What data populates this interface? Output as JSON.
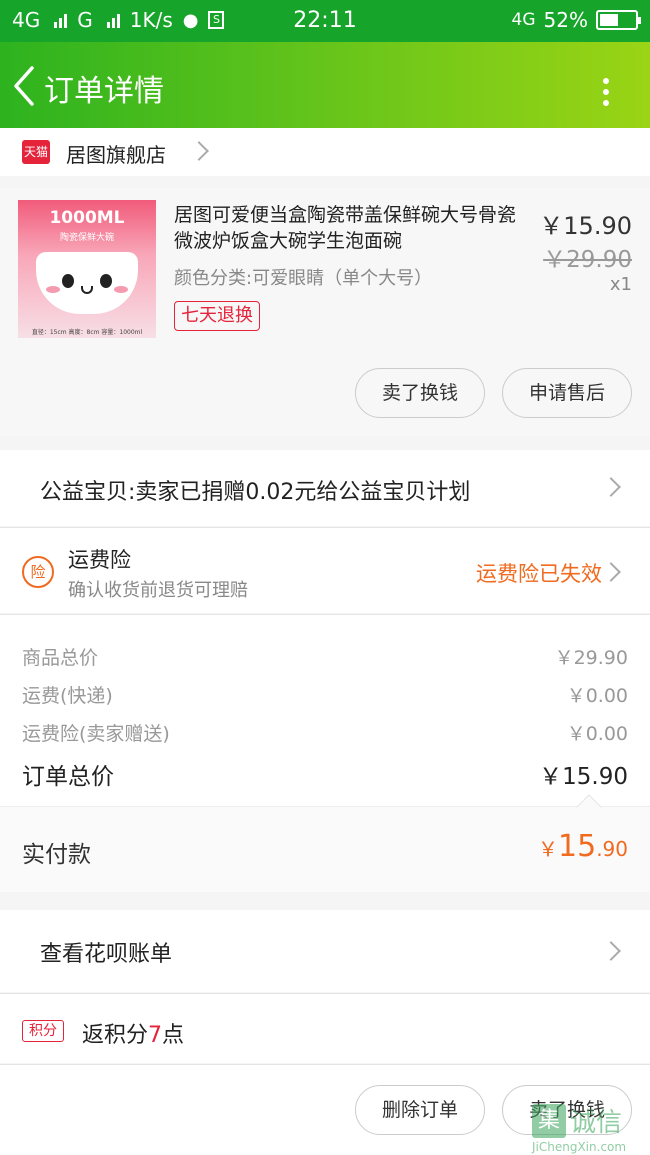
{
  "status_bar": {
    "network1": "4G",
    "network2": "G",
    "speed": "1K/s",
    "time": "22:11",
    "network3": "4G",
    "battery": "52%",
    "battery_level": 0.52
  },
  "nav": {
    "title": "订单详情",
    "badge_count": "1"
  },
  "shop": {
    "logo_text": "天猫",
    "name": "居图旗舰店"
  },
  "product": {
    "image_title": "1000ML",
    "image_subtitle": "陶瓷保鲜大碗",
    "image_footer": "直径：15cm 高度：8cm 容量：1000ml",
    "title": "居图可爱便当盒陶瓷带盖保鲜碗大号骨瓷微波炉饭盒大碗学生泡面碗",
    "spec": "颜色分类:可爱眼睛（单个大号）",
    "return_tag": "七天退换",
    "price": "￥15.90",
    "original_price": "￥29.90",
    "quantity": "x1",
    "btn_sell": "卖了换钱",
    "btn_aftersale": "申请售后"
  },
  "charity": {
    "text": "公益宝贝:卖家已捐赠0.02元给公益宝贝计划"
  },
  "insurance": {
    "icon_text": "险",
    "title": "运费险",
    "subtitle": "确认收货前退货可理赔",
    "status": "运费险已失效"
  },
  "summary": {
    "rows": [
      {
        "label": "商品总价",
        "value": "￥29.90"
      },
      {
        "label": "运费(快递)",
        "value": "￥0.00"
      },
      {
        "label": "运费险(卖家赠送)",
        "value": "￥0.00"
      }
    ],
    "total_label": "订单总价",
    "total_value": "￥15.90"
  },
  "paid": {
    "label": "实付款",
    "currency": "￥",
    "integer": "15",
    "decimal": ".90"
  },
  "huabei": {
    "text": "查看花呗账单"
  },
  "points": {
    "badge": "积分",
    "prefix": "返积分",
    "number": "7",
    "suffix": "点"
  },
  "footer": {
    "btn_delete": "删除订单",
    "btn_sell": "卖了换钱"
  },
  "watermark": {
    "mark": "集",
    "text": "诚信",
    "url": "JiChengXin.com"
  },
  "colors": {
    "nav_green": "#16a52a",
    "accent_orange": "#f06a1f",
    "tmall_red": "#e5233b"
  }
}
